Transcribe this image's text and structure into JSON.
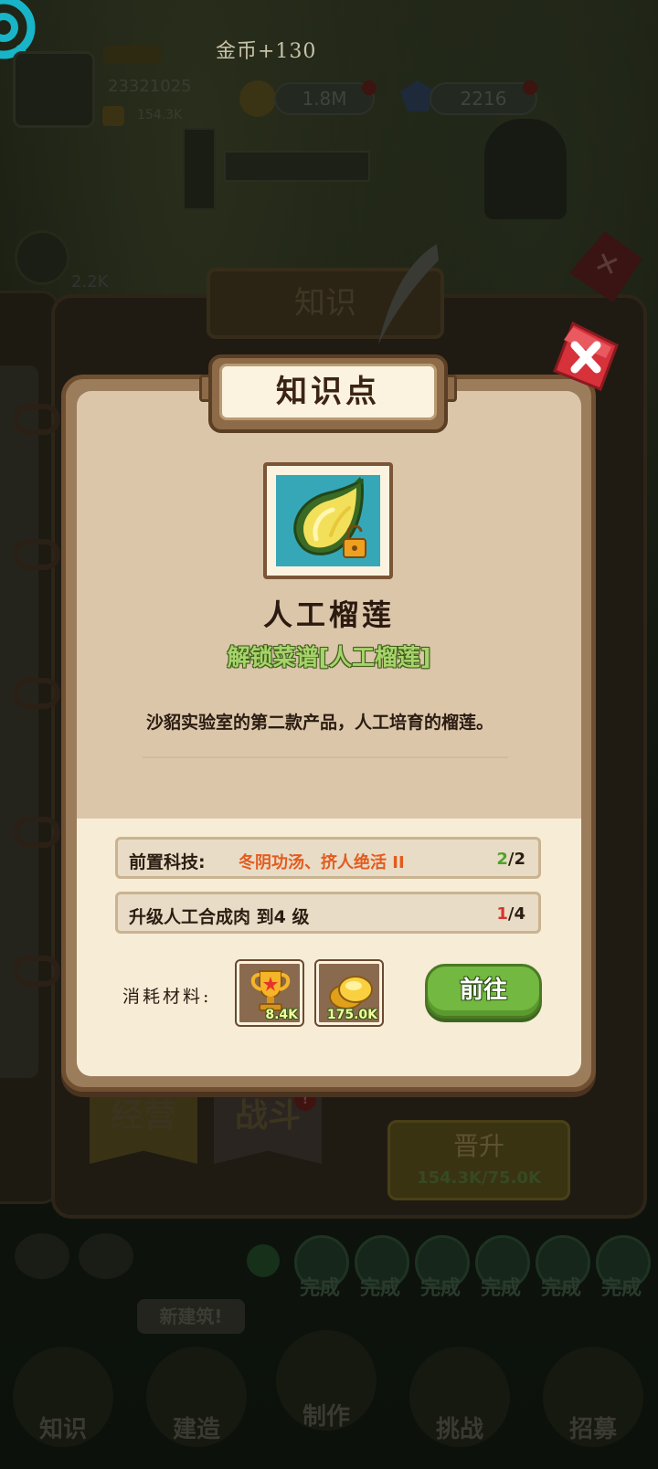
{
  "background": {
    "coin_gain": "金币+130",
    "player_id": "23321025",
    "player_score": "154.3K",
    "coins": "1.8M",
    "gems": "2216",
    "side_value": "2.2K",
    "book_title": "知识",
    "tabs": {
      "business": "经营",
      "battle": "战斗"
    },
    "upgrade": {
      "label": "晋升",
      "progress": "154.3K/75.0K"
    },
    "done_label": "完成",
    "new_build": "新建筑!",
    "nav": [
      "知识",
      "建造",
      "制作",
      "挑战",
      "招募"
    ]
  },
  "modal": {
    "title": "知识点",
    "item_name": "人工榴莲",
    "unlock": "解锁菜谱[人工榴莲]",
    "description": "沙貂实验室的第二款产品，人工培育的榴莲。",
    "requirements": [
      {
        "label": "前置科技:",
        "detail": "冬阴功汤、挤人绝活 II",
        "current": "2",
        "total": "/2",
        "met": true
      },
      {
        "label": "升级人工合成肉 到4 级",
        "detail": "",
        "current": "1",
        "total": "/4",
        "met": false
      }
    ],
    "materials_label": "消耗材料:",
    "materials": [
      {
        "icon": "trophy-icon",
        "amount": "8.4K"
      },
      {
        "icon": "gold-coins-icon",
        "amount": "175.0K"
      }
    ],
    "go_button": "前往"
  },
  "colors": {
    "panel": "#dcc6aa",
    "panel_light": "#f7ecd6",
    "frame": "#9b7d5c",
    "unlock_green": "#a7d46a",
    "req_orange": "#e35b1e",
    "go_green": "#73b840",
    "close_red": "#d7313a"
  }
}
